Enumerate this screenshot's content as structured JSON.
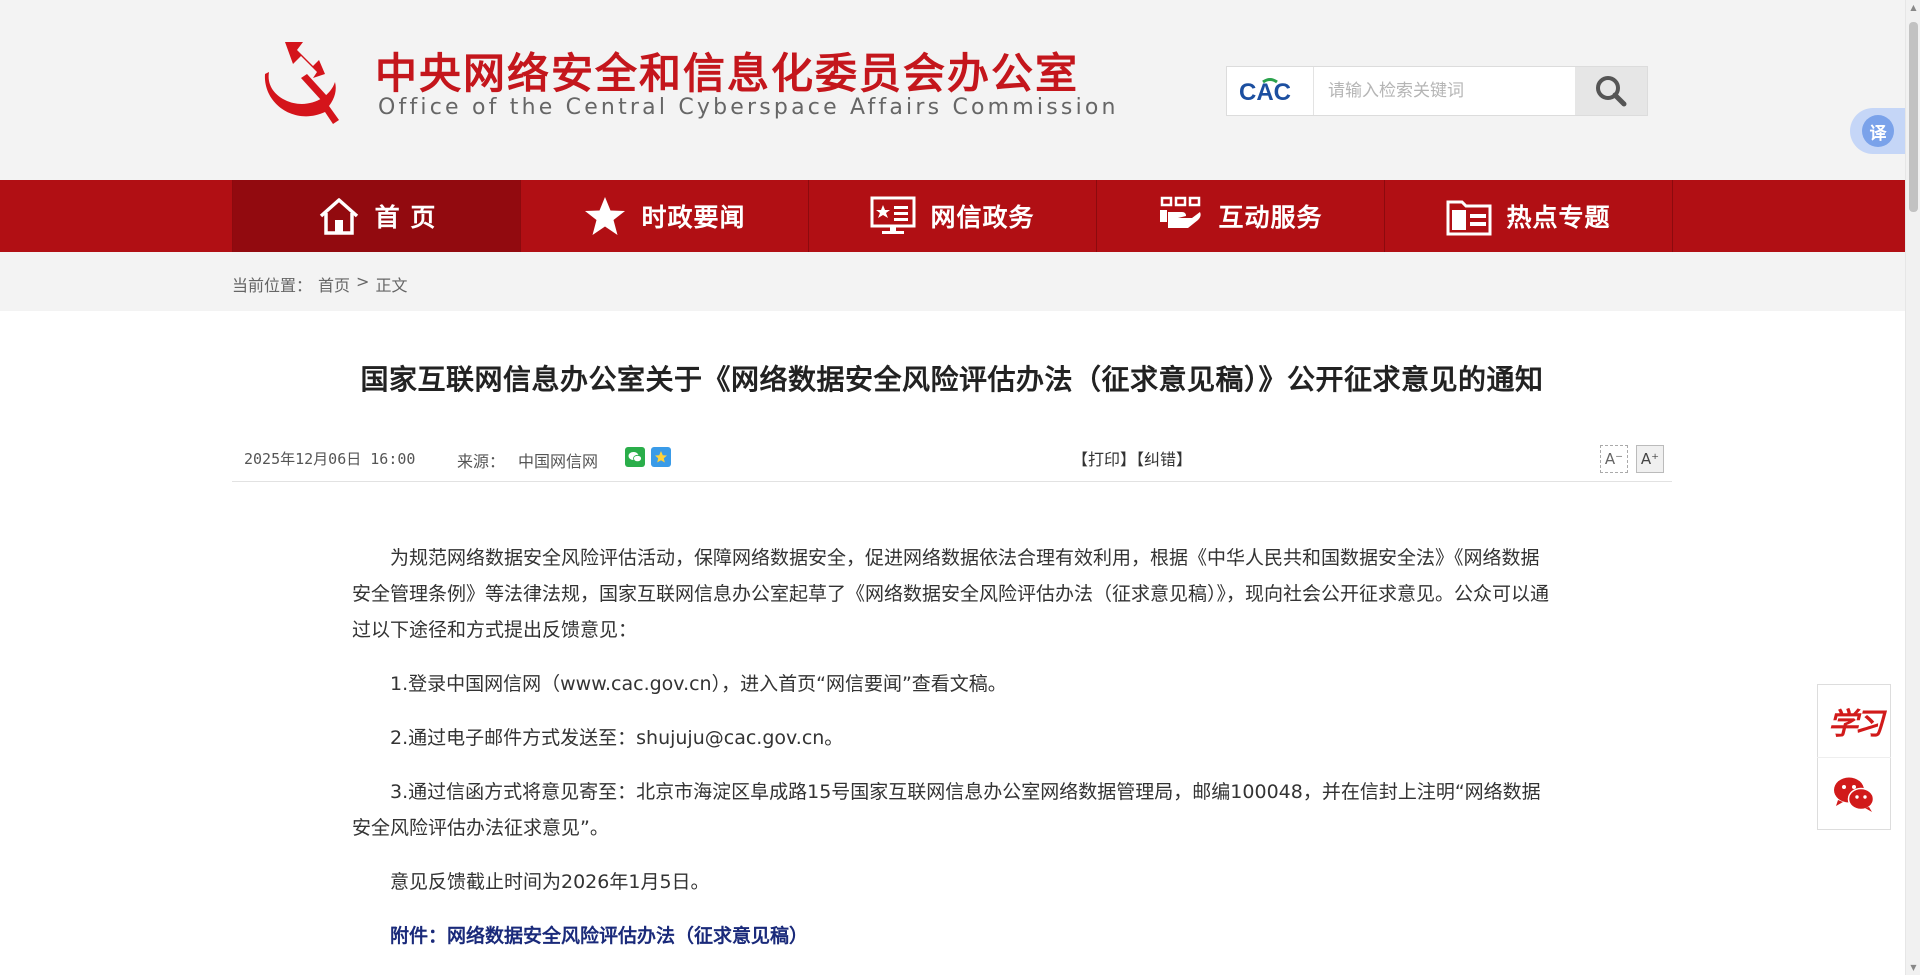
{
  "header": {
    "title_cn": "中央网络安全和信息化委员会办公室",
    "title_en": "Office of the Central Cyberspace Affairs Commission",
    "search_logo_text": "CAC",
    "search_placeholder": "请输入检索关键词",
    "translate_label": "译"
  },
  "nav": {
    "items": [
      {
        "label": "首 页",
        "icon": "home-icon"
      },
      {
        "label": "时政要闻",
        "icon": "star-icon"
      },
      {
        "label": "网信政务",
        "icon": "monitor-star-icon"
      },
      {
        "label": "互动服务",
        "icon": "hands-service-icon"
      },
      {
        "label": "热点专题",
        "icon": "folder-icon"
      }
    ]
  },
  "breadcrumb": {
    "prefix": "当前位置：",
    "home": "首页",
    "separator": ">",
    "current": "正文"
  },
  "article": {
    "title": "国家互联网信息办公室关于《网络数据安全风险评估办法（征求意见稿）》公开征求意见的通知",
    "date": "2025年12月06日 16:00",
    "source_label": "来源：",
    "source": "中国网信网",
    "print_label": "【打印】",
    "correct_label": "【纠错】",
    "font_small": "A⁻",
    "font_large": "A⁺",
    "paragraphs": [
      "为规范网络数据安全风险评估活动，保障网络数据安全，促进网络数据依法合理有效利用，根据《中华人民共和国数据安全法》《网络数据安全管理条例》等法律法规，国家互联网信息办公室起草了《网络数据安全风险评估办法（征求意见稿）》，现向社会公开征求意见。公众可以通过以下途径和方式提出反馈意见：",
      "1.登录中国网信网（www.cac.gov.cn），进入首页“网信要闻”查看文稿。",
      "2.通过电子邮件方式发送至：shujuju@cac.gov.cn。",
      "3.通过信函方式将意见寄至：北京市海淀区阜成路15号国家互联网信息办公室网络数据管理局，邮编100048，并在信封上注明“网络数据安全风险评估办法征求意见”。",
      "意见反馈截止时间为2026年1月5日。"
    ],
    "attachment": "附件：网络数据安全风险评估办法（征求意见稿）"
  },
  "float_panel": {
    "xuexi_label": "学习",
    "wechat_icon": "wechat-icon"
  },
  "colors": {
    "brand_red": "#b10f14",
    "nav_active": "#920a0f",
    "title_red": "#c4161c",
    "attachment_blue": "#1a2a7a"
  }
}
